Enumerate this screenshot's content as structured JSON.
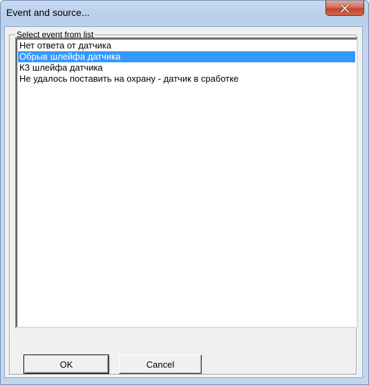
{
  "window": {
    "title": "Event and source..."
  },
  "group": {
    "label": "Select event from list"
  },
  "list": {
    "items": [
      "Нет ответа от датчика",
      "Обрыв шлейфа датчика",
      "КЗ шлейфа датчика",
      "Не удалось поставить на охрану - датчик в сработке"
    ],
    "selected_index": 1
  },
  "buttons": {
    "ok_label": "OK",
    "cancel_label": "Cancel"
  },
  "icons": {
    "close": "close-icon"
  },
  "colors": {
    "selection_bg": "#3399ff",
    "selection_fg": "#ffffff",
    "close_button": "#c3472e"
  }
}
